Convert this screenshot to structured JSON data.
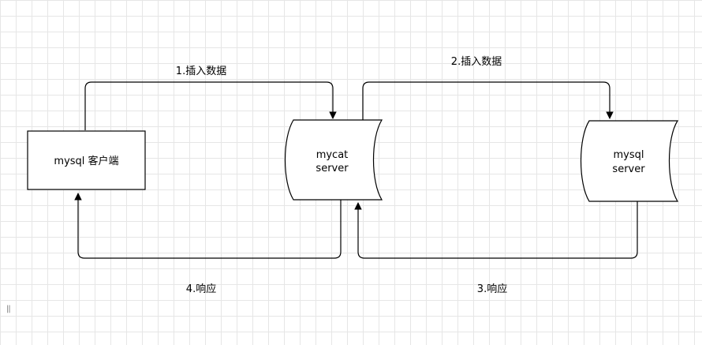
{
  "nodes": {
    "client": {
      "label": "mysql 客户端"
    },
    "mycat": {
      "line1": "mycat",
      "line2": "server"
    },
    "mysql": {
      "line1": "mysql",
      "line2": "server"
    }
  },
  "edges": {
    "step1": "1.插入数据",
    "step2": "2.插入数据",
    "step3": "3.响应",
    "step4": "4.响应"
  },
  "panel_handle": "||"
}
